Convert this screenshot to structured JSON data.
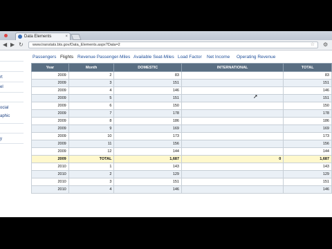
{
  "browser": {
    "tab_title": "Data Elements",
    "url": "www.transtats.bts.gov/Data_Elements.aspx?Data=2"
  },
  "sidebar": {
    "items": [
      "rt",
      "el",
      "ocial",
      "aphic",
      "y"
    ]
  },
  "nav": {
    "links": [
      {
        "label": "Passengers",
        "active": false
      },
      {
        "label": "Flights",
        "active": true
      },
      {
        "label": "Revenue Passenger-Miles",
        "active": false
      },
      {
        "label": "Available Seat-Miles",
        "active": false
      },
      {
        "label": "Load Factor",
        "active": false
      },
      {
        "label": "Net Income",
        "active": false
      },
      {
        "label": "Operating Revenue",
        "active": false
      }
    ]
  },
  "table": {
    "headers": [
      "Year",
      "Month",
      "DOMESTIC",
      "INTERNATIONAL",
      "TOTAL"
    ],
    "rows": [
      {
        "year": "2009",
        "month": "2",
        "domestic": "83",
        "international": "",
        "total": "83",
        "kind": "normal"
      },
      {
        "year": "2009",
        "month": "3",
        "domestic": "151",
        "international": "",
        "total": "151",
        "kind": "normal"
      },
      {
        "year": "2009",
        "month": "4",
        "domestic": "146",
        "international": "",
        "total": "146",
        "kind": "normal"
      },
      {
        "year": "2009",
        "month": "5",
        "domestic": "151",
        "international": "",
        "total": "151",
        "kind": "normal"
      },
      {
        "year": "2009",
        "month": "6",
        "domestic": "150",
        "international": "",
        "total": "150",
        "kind": "normal"
      },
      {
        "year": "2009",
        "month": "7",
        "domestic": "178",
        "international": "",
        "total": "178",
        "kind": "normal"
      },
      {
        "year": "2009",
        "month": "8",
        "domestic": "186",
        "international": "",
        "total": "186",
        "kind": "normal"
      },
      {
        "year": "2009",
        "month": "9",
        "domestic": "169",
        "international": "",
        "total": "169",
        "kind": "normal"
      },
      {
        "year": "2009",
        "month": "10",
        "domestic": "173",
        "international": "",
        "total": "173",
        "kind": "normal"
      },
      {
        "year": "2009",
        "month": "11",
        "domestic": "156",
        "international": "",
        "total": "156",
        "kind": "normal"
      },
      {
        "year": "2009",
        "month": "12",
        "domestic": "144",
        "international": "",
        "total": "144",
        "kind": "normal"
      },
      {
        "year": "2009",
        "month": "TOTAL",
        "domestic": "1,687",
        "international": "0",
        "total": "1,687",
        "kind": "total"
      },
      {
        "year": "2010",
        "month": "1",
        "domestic": "143",
        "international": "",
        "total": "143",
        "kind": "normal"
      },
      {
        "year": "2010",
        "month": "2",
        "domestic": "129",
        "international": "",
        "total": "129",
        "kind": "normal"
      },
      {
        "year": "2010",
        "month": "3",
        "domestic": "151",
        "international": "",
        "total": "151",
        "kind": "normal"
      },
      {
        "year": "2010",
        "month": "4",
        "domestic": "146",
        "international": "",
        "total": "146",
        "kind": "normal"
      }
    ]
  },
  "colors": {
    "header_bg": "#596e82",
    "total_row_bg": "#fff8cc",
    "alt_row_bg": "#eaf0f6",
    "link": "#1f4f9a"
  }
}
